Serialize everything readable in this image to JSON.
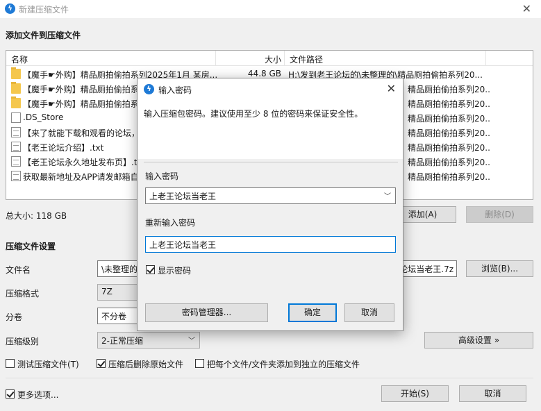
{
  "window": {
    "title": "新建压缩文件",
    "close_icon": "✕"
  },
  "add_section": {
    "title": "添加文件到压缩文件"
  },
  "file_list": {
    "columns": {
      "name": "名称",
      "size": "大小",
      "path": "文件路径"
    },
    "rows": [
      {
        "icon": "folder-icon",
        "name": "【魔手☛外购】精品厕拍偷拍系列2025年1月 某房...",
        "size": "44.8 GB",
        "path": "H:\\发到老王论坛的\\未整理的\\精品厕拍偷拍系列20..."
      },
      {
        "icon": "folder-icon",
        "name": "【魔手☛外购】精品厕拍偷拍系",
        "size": "",
        "path": "精品厕拍偷拍系列20..."
      },
      {
        "icon": "folder-icon",
        "name": "【魔手☛外购】精品厕拍偷拍系",
        "size": "",
        "path": "精品厕拍偷拍系列20..."
      },
      {
        "icon": "file-icon",
        "name": ".DS_Store",
        "size": "",
        "path": "精品厕拍偷拍系列20..."
      },
      {
        "icon": "text-file-icon",
        "name": "【来了就能下载和观看的论坛，",
        "size": "",
        "path": "精品厕拍偷拍系列20..."
      },
      {
        "icon": "text-file-icon",
        "name": "【老王论坛介绍】.txt",
        "size": "",
        "path": "精品厕拍偷拍系列20..."
      },
      {
        "icon": "text-file-icon",
        "name": "【老王论坛永久地址发布页】.t",
        "size": "",
        "path": "精品厕拍偷拍系列20..."
      },
      {
        "icon": "text-file-icon",
        "name": "获取最新地址及APP请发邮箱自",
        "size": "",
        "path": "精品厕拍偷拍系列20..."
      }
    ]
  },
  "total_size": "总大小: 118 GB",
  "buttons": {
    "add": "添加(A)",
    "delete": "删除(D)",
    "browse": "浏览(B)...",
    "advanced": "高级设置 »",
    "start": "开始(S)",
    "cancel": "取消"
  },
  "settings": {
    "title": "压缩文件设置",
    "filename_label": "文件名",
    "filename_left": "\\未整理的",
    "filename_right": "论坛当老王.7z",
    "format_label": "压缩格式",
    "format_value": "7Z",
    "split_label": "分卷",
    "split_value": "不分卷",
    "level_label": "压缩级别",
    "level_value": "2-正常压缩",
    "test_label": "测试压缩文件(T)",
    "test_checked": false,
    "delete_after_label": "压缩后删除原始文件",
    "delete_after_checked": true,
    "each_separate_label": "把每个文件/文件夹添加到独立的压缩文件",
    "each_separate_checked": false,
    "more_options_label": "更多选项...",
    "more_options_checked": true
  },
  "dialog": {
    "title": "输入密码",
    "description": "输入压缩包密码。建议使用至少 8 位的密码来保证安全性。",
    "password_label": "输入密码",
    "password_value": "上老王论坛当老王",
    "reenter_label": "重新输入密码",
    "reenter_value": "上老王论坛当老王",
    "show_password_label": "显示密码",
    "show_password_checked": true,
    "manager_button": "密码管理器...",
    "ok_button": "确定",
    "cancel_button": "取消"
  }
}
